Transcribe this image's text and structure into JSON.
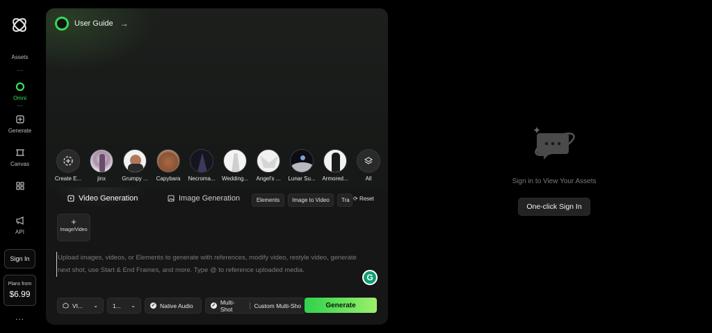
{
  "sidebar": {
    "items": [
      {
        "label": "Assets"
      },
      {
        "label": "Omni"
      },
      {
        "label": "Generate"
      },
      {
        "label": "Canvas"
      },
      {
        "label": "API"
      }
    ],
    "sign_in": "Sign In",
    "plans_label": "Plans from",
    "plans_price": "$6.99",
    "more": "..."
  },
  "panel": {
    "guide_label": "User Guide",
    "chips": [
      {
        "label": "Create E..."
      },
      {
        "label": "jinx"
      },
      {
        "label": "Grumpy ..."
      },
      {
        "label": "Capybara"
      },
      {
        "label": "Necroma..."
      },
      {
        "label": "Wedding..."
      },
      {
        "label": "Angel's ..."
      },
      {
        "label": "Lunar Su..."
      },
      {
        "label": "Armored..."
      },
      {
        "label": "All"
      }
    ],
    "tabs": [
      {
        "label": "Video Generation"
      },
      {
        "label": "Image Generation"
      }
    ],
    "pills": [
      "Elements",
      "Image to Video",
      "Tra"
    ],
    "reset_label": "Reset",
    "upload_label": "Image/Video",
    "upload_plus": "+",
    "prompt_placeholder": "Upload images, videos, or Elements to generate with references, modify video, restyle video, generate next shot, use Start & End Frames, and more. Type @ to reference uploaded media.",
    "model_select": "VI...",
    "count_select": "1...",
    "native_audio": "Native Audio",
    "multi_shot": "Multi-Shot",
    "custom_multi": "Custom Multi-Sho",
    "generate_label": "Generate",
    "badge_letter": "G"
  },
  "right": {
    "assets_text": "Sign in to View Your Assets",
    "oneclick_label": "One-click Sign In"
  },
  "colors": {
    "accent": "#34d955",
    "background": "#000000",
    "panel": "#1a1c1b"
  }
}
